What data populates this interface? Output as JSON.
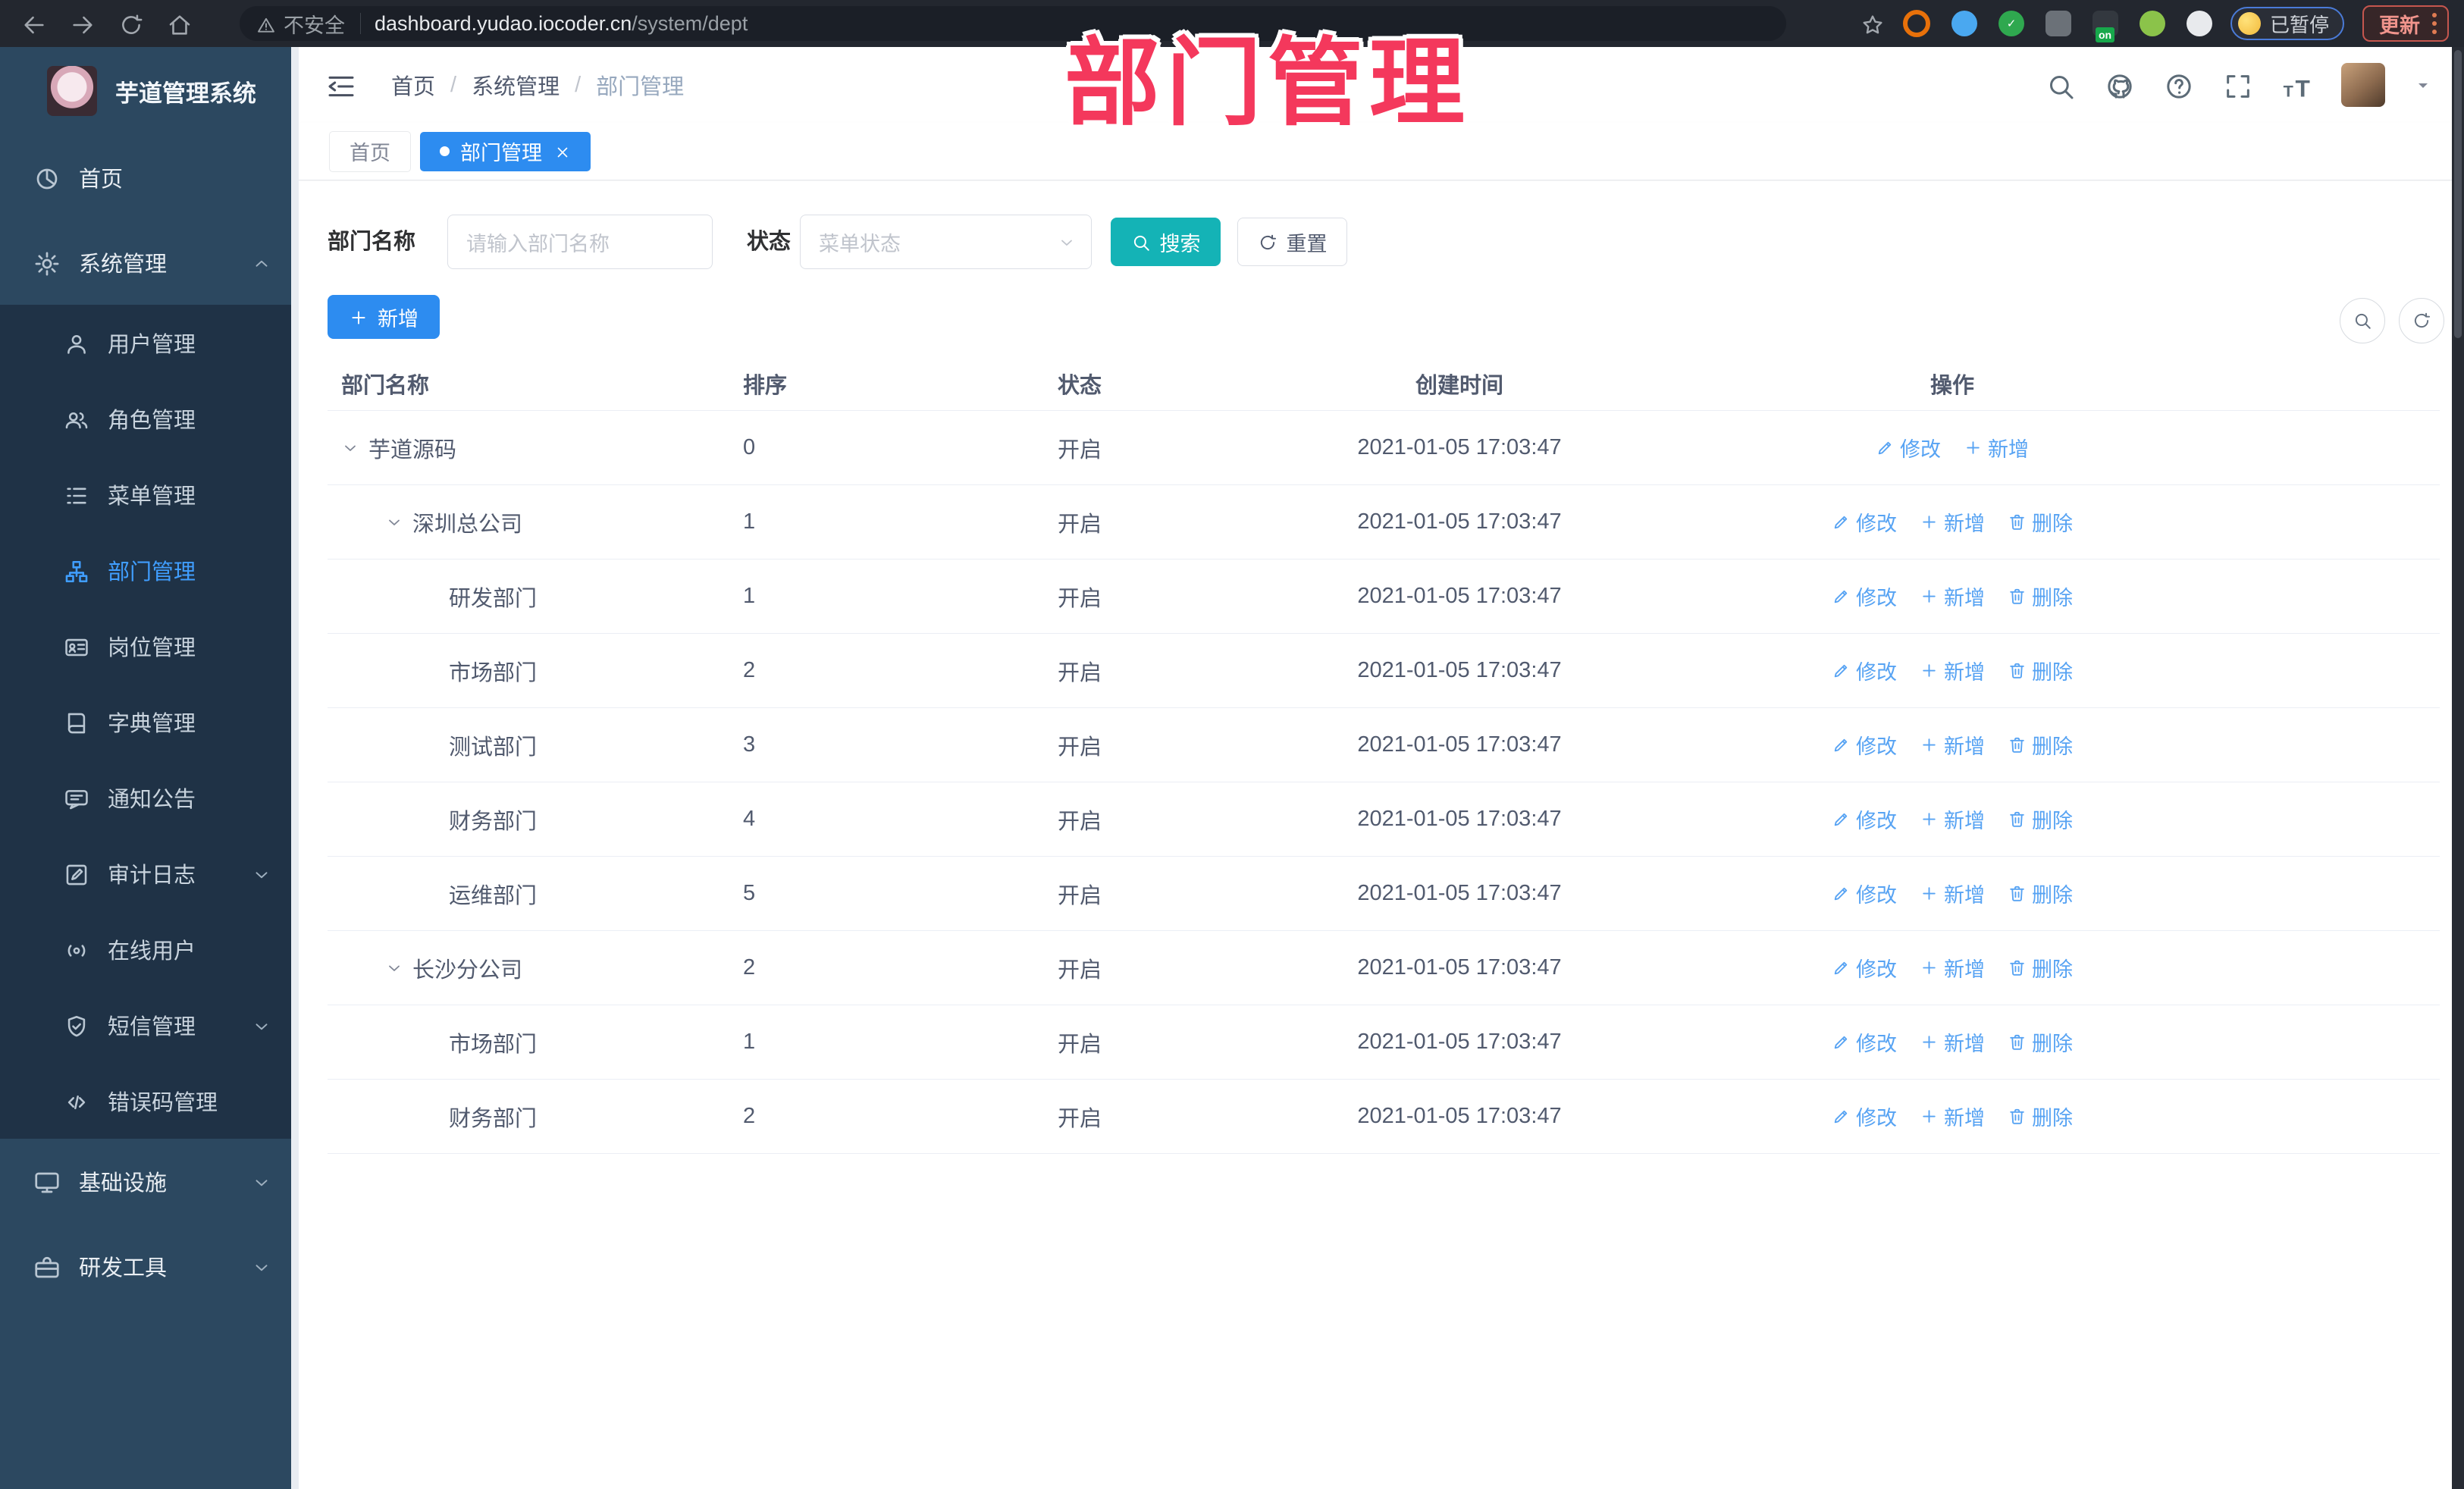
{
  "overlay_title": "部门管理",
  "browser": {
    "security_label": "不安全",
    "url_domain": "dashboard.yudao.iocoder.cn",
    "url_path": "/system/dept",
    "paused_badge": "已暂停",
    "update_button": "更新",
    "extensions": [
      {
        "name": "extension-orange-icon",
        "shape": "ring",
        "color": "#e8710a"
      },
      {
        "name": "extension-gem-icon",
        "shape": "circle",
        "color": "#4aa8f0"
      },
      {
        "name": "extension-green-check-icon",
        "shape": "circle",
        "color": "#2fa84f",
        "glyph": "✓"
      },
      {
        "name": "extension-tiles-icon",
        "shape": "square",
        "color": "#6b7178"
      },
      {
        "name": "extension-switch-icon",
        "shape": "square",
        "color": "#33383f",
        "badge": "on"
      },
      {
        "name": "extension-key-icon",
        "shape": "circle",
        "color": "#8bc34a"
      },
      {
        "name": "extension-puzzle-icon",
        "shape": "circle",
        "color": "#e8eaed"
      }
    ]
  },
  "sidebar": {
    "app_title": "芋道管理系统",
    "items": [
      {
        "id": "home",
        "label": "首页",
        "icon": "dashboard-icon",
        "level": 0
      },
      {
        "id": "system-management",
        "label": "系统管理",
        "icon": "gear-icon",
        "level": 0,
        "chevron": "up"
      },
      {
        "id": "user-management",
        "label": "用户管理",
        "icon": "user-icon",
        "level": 1
      },
      {
        "id": "role-management",
        "label": "角色管理",
        "icon": "roles-icon",
        "level": 1
      },
      {
        "id": "menu-management",
        "label": "菜单管理",
        "icon": "menu-list-icon",
        "level": 1
      },
      {
        "id": "dept-management",
        "label": "部门管理",
        "icon": "org-tree-icon",
        "level": 1,
        "active": true
      },
      {
        "id": "post-management",
        "label": "岗位管理",
        "icon": "id-card-icon",
        "level": 1
      },
      {
        "id": "dict-management",
        "label": "字典管理",
        "icon": "dictionary-icon",
        "level": 1
      },
      {
        "id": "notice",
        "label": "通知公告",
        "icon": "announcement-icon",
        "level": 1
      },
      {
        "id": "audit-log",
        "label": "审计日志",
        "icon": "audit-log-icon",
        "level": 1,
        "chevron": "down"
      },
      {
        "id": "online-users",
        "label": "在线用户",
        "icon": "online-users-icon",
        "level": 1
      },
      {
        "id": "sms-management",
        "label": "短信管理",
        "icon": "sms-icon",
        "level": 1,
        "chevron": "down"
      },
      {
        "id": "error-code",
        "label": "错误码管理",
        "icon": "error-code-icon",
        "level": 1
      },
      {
        "id": "infrastructure",
        "label": "基础设施",
        "icon": "infrastructure-icon",
        "level": 0,
        "chevron": "down"
      },
      {
        "id": "dev-tools",
        "label": "研发工具",
        "icon": "dev-tools-icon",
        "level": 0,
        "chevron": "down"
      }
    ]
  },
  "header": {
    "breadcrumb": [
      "首页",
      "系统管理",
      "部门管理"
    ],
    "icons": [
      "search-icon",
      "github-icon",
      "help-icon",
      "fullscreen-icon",
      "font-size-icon"
    ]
  },
  "tabs": [
    {
      "id": "home",
      "label": "首页",
      "active": false
    },
    {
      "id": "dept",
      "label": "部门管理",
      "active": true,
      "closable": true
    }
  ],
  "filter": {
    "name_label": "部门名称",
    "name_placeholder": "请输入部门名称",
    "status_label": "状态",
    "status_placeholder": "菜单状态",
    "search_label": "搜索",
    "reset_label": "重置"
  },
  "toolbar": {
    "add_label": "新增"
  },
  "table": {
    "headers": [
      "部门名称",
      "排序",
      "状态",
      "创建时间",
      "操作"
    ],
    "action_labels": {
      "modify": "修改",
      "add": "新增",
      "delete": "删除"
    },
    "rows": [
      {
        "name": "芋道源码",
        "indent": 0,
        "expandable": true,
        "sort": "0",
        "status": "开启",
        "created": "2021-01-05 17:03:47",
        "actions": [
          "modify",
          "add"
        ]
      },
      {
        "name": "深圳总公司",
        "indent": 1,
        "expandable": true,
        "sort": "1",
        "status": "开启",
        "created": "2021-01-05 17:03:47",
        "actions": [
          "modify",
          "add",
          "delete"
        ]
      },
      {
        "name": "研发部门",
        "indent": 2,
        "expandable": false,
        "sort": "1",
        "status": "开启",
        "created": "2021-01-05 17:03:47",
        "actions": [
          "modify",
          "add",
          "delete"
        ]
      },
      {
        "name": "市场部门",
        "indent": 2,
        "expandable": false,
        "sort": "2",
        "status": "开启",
        "created": "2021-01-05 17:03:47",
        "actions": [
          "modify",
          "add",
          "delete"
        ]
      },
      {
        "name": "测试部门",
        "indent": 2,
        "expandable": false,
        "sort": "3",
        "status": "开启",
        "created": "2021-01-05 17:03:47",
        "actions": [
          "modify",
          "add",
          "delete"
        ]
      },
      {
        "name": "财务部门",
        "indent": 2,
        "expandable": false,
        "sort": "4",
        "status": "开启",
        "created": "2021-01-05 17:03:47",
        "actions": [
          "modify",
          "add",
          "delete"
        ]
      },
      {
        "name": "运维部门",
        "indent": 2,
        "expandable": false,
        "sort": "5",
        "status": "开启",
        "created": "2021-01-05 17:03:47",
        "actions": [
          "modify",
          "add",
          "delete"
        ]
      },
      {
        "name": "长沙分公司",
        "indent": 1,
        "expandable": true,
        "sort": "2",
        "status": "开启",
        "created": "2021-01-05 17:03:47",
        "actions": [
          "modify",
          "add",
          "delete"
        ]
      },
      {
        "name": "市场部门",
        "indent": 2,
        "expandable": false,
        "sort": "1",
        "status": "开启",
        "created": "2021-01-05 17:03:47",
        "actions": [
          "modify",
          "add",
          "delete"
        ]
      },
      {
        "name": "财务部门",
        "indent": 2,
        "expandable": false,
        "sort": "2",
        "status": "开启",
        "created": "2021-01-05 17:03:47",
        "actions": [
          "modify",
          "add",
          "delete"
        ]
      }
    ]
  }
}
